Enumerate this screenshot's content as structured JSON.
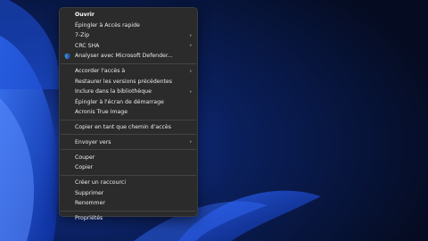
{
  "context_menu": {
    "items": [
      {
        "label": "Ouvrir"
      },
      {
        "label": "Épingler à Accès rapide"
      },
      {
        "label": "7-Zip"
      },
      {
        "label": "CRC SHA"
      },
      {
        "label": "Analyser avec Microsoft Defender..."
      },
      {
        "label": "Accorder l'accès à"
      },
      {
        "label": "Restaurer les versions précédentes"
      },
      {
        "label": "Inclure dans la bibliothèque"
      },
      {
        "label": "Épingler à l'écran de démarrage"
      },
      {
        "label": "Acronis True Image"
      },
      {
        "label": "Copier en tant que chemin d'accès"
      },
      {
        "label": "Envoyer vers"
      },
      {
        "label": "Couper"
      },
      {
        "label": "Copier"
      },
      {
        "label": "Créer un raccourci"
      },
      {
        "label": "Supprimer"
      },
      {
        "label": "Renommer"
      },
      {
        "label": "Propriétés"
      }
    ],
    "submenu_glyph": "›",
    "defender_icon": "shield-icon",
    "colors": {
      "menu_bg": "#2b2b2b",
      "text": "#ececec",
      "separator": "#444444",
      "accent": "#3a86d8"
    }
  }
}
